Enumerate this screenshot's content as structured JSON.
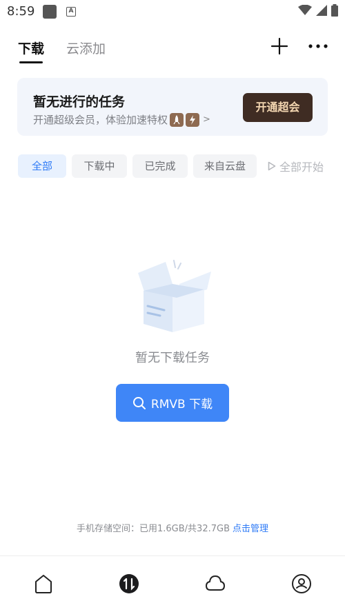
{
  "status_bar": {
    "time": "8:59",
    "a_icon_label": "A"
  },
  "header": {
    "tabs": [
      {
        "label": "下载",
        "active": true
      },
      {
        "label": "云添加",
        "active": false
      }
    ],
    "plus_icon": "plus-icon",
    "more_icon": "more-icon"
  },
  "vip_banner": {
    "title": "暂无进行的任务",
    "subtitle": "开通超级会员，体验加速特权",
    "arrow": ">",
    "button_label": "开通超会",
    "colors": {
      "background": "#f2f5fb",
      "button": "#3f2c23",
      "button_text": "#f3d6b1"
    }
  },
  "filters": {
    "items": [
      "全部",
      "下载中",
      "已完成",
      "来自云盘"
    ],
    "active_index": 0,
    "start_all_label": "全部开始"
  },
  "empty_state": {
    "message": "暂无下载任务",
    "button_label": "RMVB 下载",
    "icon": "search-icon"
  },
  "storage": {
    "label": "手机存储空间：已用1.6GB/共32.7GB",
    "link": "点击管理"
  },
  "bottom_nav": {
    "items": [
      "home-icon",
      "transfer-icon",
      "cloud-icon",
      "profile-icon"
    ],
    "active_index": 1
  },
  "colors": {
    "accent": "#3f86f7",
    "link": "#2f7bf6"
  }
}
